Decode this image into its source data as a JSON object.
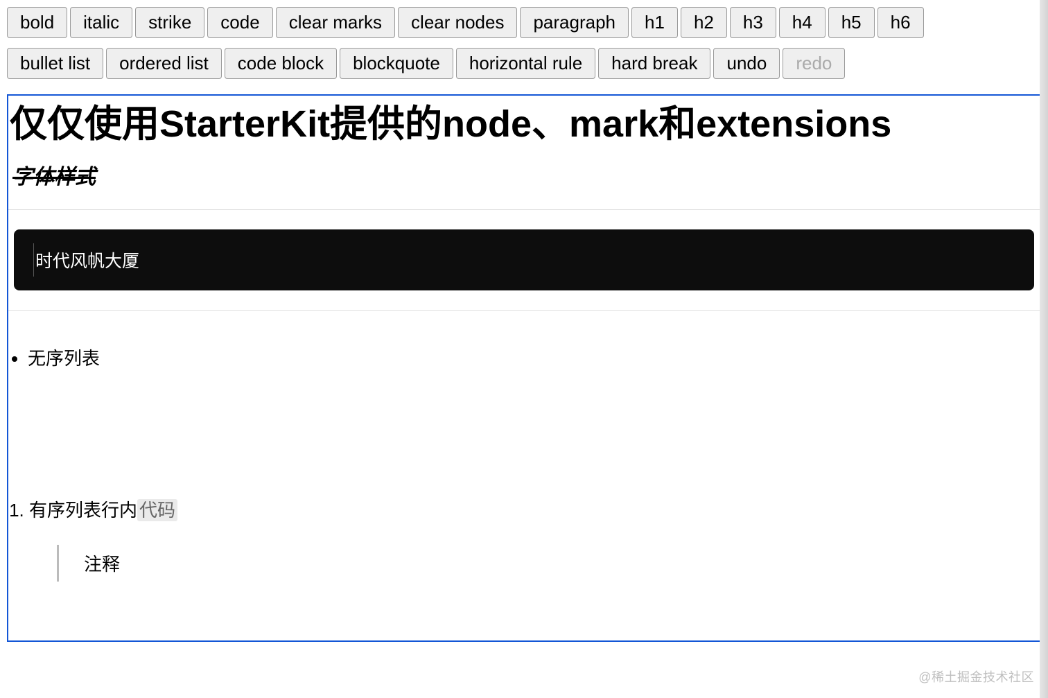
{
  "toolbar": {
    "row1": [
      {
        "name": "bold-button",
        "label": "bold",
        "disabled": false
      },
      {
        "name": "italic-button",
        "label": "italic",
        "disabled": false
      },
      {
        "name": "strike-button",
        "label": "strike",
        "disabled": false
      },
      {
        "name": "code-button",
        "label": "code",
        "disabled": false
      },
      {
        "name": "clear-marks-button",
        "label": "clear marks",
        "disabled": false
      },
      {
        "name": "clear-nodes-button",
        "label": "clear nodes",
        "disabled": false
      },
      {
        "name": "paragraph-button",
        "label": "paragraph",
        "disabled": false
      },
      {
        "name": "h1-button",
        "label": "h1",
        "disabled": false
      },
      {
        "name": "h2-button",
        "label": "h2",
        "disabled": false
      },
      {
        "name": "h3-button",
        "label": "h3",
        "disabled": false
      },
      {
        "name": "h4-button",
        "label": "h4",
        "disabled": false
      },
      {
        "name": "h5-button",
        "label": "h5",
        "disabled": false
      },
      {
        "name": "h6-button",
        "label": "h6",
        "disabled": false
      }
    ],
    "row2": [
      {
        "name": "bullet-list-button",
        "label": "bullet list",
        "disabled": false
      },
      {
        "name": "ordered-list-button",
        "label": "ordered list",
        "disabled": false
      },
      {
        "name": "code-block-button",
        "label": "code block",
        "disabled": false
      },
      {
        "name": "blockquote-button",
        "label": "blockquote",
        "disabled": false
      },
      {
        "name": "horizontal-rule-button",
        "label": "horizontal rule",
        "disabled": false
      },
      {
        "name": "hard-break-button",
        "label": "hard break",
        "disabled": false
      },
      {
        "name": "undo-button",
        "label": "undo",
        "disabled": false
      },
      {
        "name": "redo-button",
        "label": "redo",
        "disabled": true
      }
    ]
  },
  "content": {
    "heading1": "仅仅使用StarterKit提供的node、mark和extensions",
    "heading2_styled": "字体样式",
    "code_block_text": "时代风帆大厦",
    "unordered_item": "无序列表",
    "ordered_item_text": "有序列表行内",
    "ordered_item_code": "代码",
    "blockquote_text": "注释"
  },
  "watermark": "@稀土掘金技术社区"
}
